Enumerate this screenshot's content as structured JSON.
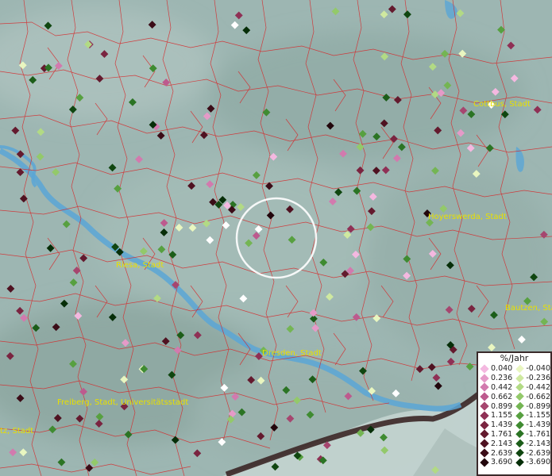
{
  "map": {
    "cities": [
      "Cottbus, Stadt",
      "Hoyerswerda, Stadt",
      "Riesa, Stadt",
      "Bautzen, Stadt",
      "Dresden, Stadt",
      "Freiberg, Stadt, Universitätsstadt",
      "tz, Stadt"
    ]
  },
  "legend": {
    "title": "%/Jahr",
    "positive": [
      "0.040",
      "0.236",
      "0.442",
      "0.662",
      "0.899",
      "1.155",
      "1.439",
      "1.761",
      "2.143",
      "2.639",
      "3.690"
    ],
    "negative": [
      "-0.040",
      "-0.236",
      "-0.442",
      "-0.662",
      "-0.899",
      "-1.155",
      "-1.439",
      "-1.761",
      "-2.143",
      "-2.639",
      "-3.690"
    ],
    "positive_colors": [
      "#f4b8e0",
      "#e59ac8",
      "#d27aae",
      "#bd5a8e",
      "#a6466f",
      "#8f3055",
      "#7a2440",
      "#641a2e",
      "#4f1221",
      "#3b0c17",
      "#22060c"
    ],
    "negative_colors": [
      "#e9f6c0",
      "#cfe9a0",
      "#b2da84",
      "#93c96a",
      "#74b553",
      "#57a040",
      "#3f8b31",
      "#2b7424",
      "#1c5d19",
      "#104610",
      "#062e08"
    ]
  }
}
